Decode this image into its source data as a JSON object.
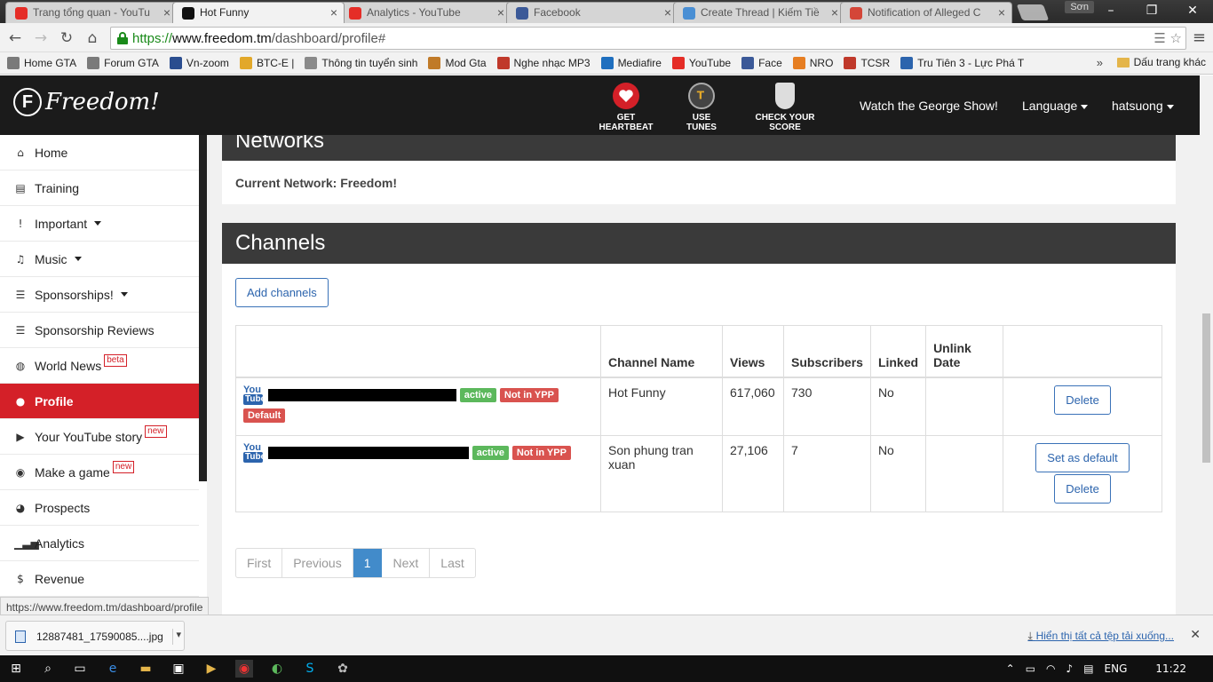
{
  "browser": {
    "tabs": [
      {
        "title": "Trang tổng quan - YouTu",
        "icon": "youtube-icon",
        "color": "#e52d27",
        "active": false
      },
      {
        "title": "Hot Funny",
        "icon": "freedom-icon",
        "color": "#111111",
        "active": true
      },
      {
        "title": "Analytics - YouTube",
        "icon": "youtube-icon",
        "color": "#e52d27",
        "active": false
      },
      {
        "title": "Facebook",
        "icon": "facebook-icon",
        "color": "#3b5998",
        "active": false
      },
      {
        "title": "Create Thread | Kiếm Tiề",
        "icon": "forum-icon",
        "color": "#4a8fd4",
        "active": false
      },
      {
        "title": "Notification of Alleged C",
        "icon": "gmail-icon",
        "color": "#d44638",
        "active": false
      }
    ],
    "profile_name": "Sơn",
    "url": {
      "scheme": "https://",
      "host": "www.freedom.tm",
      "path": "/dashboard/profile#"
    },
    "bookmarks": [
      {
        "label": "Home GTA",
        "icon": "link-icon",
        "color": "#7a7a7a"
      },
      {
        "label": "Forum GTA",
        "icon": "link-icon",
        "color": "#7a7a7a"
      },
      {
        "label": "Vn-zoom",
        "icon": "vnzoom-icon",
        "color": "#2a4d8f"
      },
      {
        "label": "BTC-E |",
        "icon": "btc-icon",
        "color": "#e2a82a"
      },
      {
        "label": "Thông tin tuyển sinh",
        "icon": "page-icon",
        "color": "#8a8a8a"
      },
      {
        "label": "Mod Gta",
        "icon": "mod-icon",
        "color": "#c07a28"
      },
      {
        "label": "Nghe nhạc MP3",
        "icon": "music-icon",
        "color": "#c0392b"
      },
      {
        "label": "Mediafire",
        "icon": "mediafire-icon",
        "color": "#1f6fbf"
      },
      {
        "label": "YouTube",
        "icon": "youtube-icon",
        "color": "#e52d27"
      },
      {
        "label": "Face",
        "icon": "facebook-icon",
        "color": "#3b5998"
      },
      {
        "label": "NRO",
        "icon": "nro-icon",
        "color": "#e67e22"
      },
      {
        "label": "TCSR",
        "icon": "tcsr-icon",
        "color": "#c0392b"
      },
      {
        "label": "Tru Tiên 3 - Lực Phá T",
        "icon": "page-icon",
        "color": "#2c64ad"
      }
    ],
    "bookmarks_more": "»",
    "bookmarks_folder": "Dấu trang khác",
    "status_url": "https://www.freedom.tm/dashboard/profile"
  },
  "site": {
    "logo_letter": "F",
    "logo_text": "Freedom!",
    "header_items": [
      {
        "label": "GET HEARTBEAT",
        "icon": "heart-icon",
        "color": "#d42028"
      },
      {
        "label": "USE TUNES",
        "icon": "tunes-icon",
        "color": "#444444"
      },
      {
        "label": "CHECK YOUR SCORE",
        "icon": "score-icon",
        "color": "#dddddd"
      }
    ],
    "watch_link": "Watch the George Show!",
    "language": "Language",
    "user": "hatsuong",
    "accent": "#d42028"
  },
  "sidebar": {
    "items": [
      {
        "label": "Home",
        "icon": "home-icon",
        "glyph": "⌂",
        "badge": "",
        "caret": false,
        "active": false
      },
      {
        "label": "Training",
        "icon": "book-icon",
        "glyph": "▤",
        "badge": "",
        "caret": false,
        "active": false
      },
      {
        "label": "Important",
        "icon": "exclamation-icon",
        "glyph": "!",
        "badge": "",
        "caret": true,
        "active": false
      },
      {
        "label": "Music",
        "icon": "music-note-icon",
        "glyph": "♫",
        "badge": "",
        "caret": true,
        "active": false
      },
      {
        "label": "Sponsorships!",
        "icon": "list-icon",
        "glyph": "☰",
        "badge": "",
        "caret": true,
        "active": false
      },
      {
        "label": "Sponsorship Reviews",
        "icon": "list-icon",
        "glyph": "☰",
        "badge": "",
        "caret": false,
        "active": false
      },
      {
        "label": "World News",
        "icon": "globe-icon",
        "glyph": "◍",
        "badge": "beta",
        "caret": false,
        "active": false
      },
      {
        "label": "Profile",
        "icon": "user-icon",
        "glyph": "●",
        "badge": "",
        "caret": false,
        "active": true
      },
      {
        "label": "Your YouTube story",
        "icon": "youtube-icon",
        "glyph": "▶",
        "badge": "new",
        "caret": false,
        "active": false
      },
      {
        "label": "Make a game",
        "icon": "gamepad-icon",
        "glyph": "◉",
        "badge": "new",
        "caret": false,
        "active": false
      },
      {
        "label": "Prospects",
        "icon": "users-icon",
        "glyph": "◕",
        "badge": "",
        "caret": false,
        "active": false
      },
      {
        "label": "Analytics",
        "icon": "signal-icon",
        "glyph": "▁▃▅",
        "badge": "",
        "caret": false,
        "active": false
      },
      {
        "label": "Revenue",
        "icon": "dollar-icon",
        "glyph": "$",
        "badge": "",
        "caret": false,
        "active": false
      }
    ]
  },
  "networks": {
    "title": "Networks",
    "current_label": "Current Network: Freedom!"
  },
  "channels": {
    "title": "Channels",
    "add_button": "Add channels",
    "columns": [
      "",
      "Channel Name",
      "Views",
      "Subscribers",
      "Linked",
      "Unlink Date",
      ""
    ],
    "rows": [
      {
        "yt_top": "You",
        "yt_bot": "Tube",
        "labels": [
          "active",
          "Not in YPP"
        ],
        "default_label": "Default",
        "name": "Hot Funny",
        "views": "617,060",
        "subscribers": "730",
        "linked": "No",
        "unlink_date": "",
        "actions": [
          "Delete"
        ]
      },
      {
        "yt_top": "You",
        "yt_bot": "Tube",
        "labels": [
          "active",
          "Not in YPP"
        ],
        "default_label": "",
        "name": "Son phung tran xuan",
        "views": "27,106",
        "subscribers": "7",
        "linked": "No",
        "unlink_date": "",
        "actions": [
          "Set as default",
          "Delete"
        ]
      }
    ],
    "pager": [
      "First",
      "Previous",
      "1",
      "Next",
      "Last"
    ],
    "current_page": "1"
  },
  "downloads": {
    "file": "12887481_17590085....jpg",
    "show_all": "Hiển thị tất cả tệp tải xuống..."
  },
  "taskbar": {
    "language": "ENG",
    "time": "11:22"
  }
}
